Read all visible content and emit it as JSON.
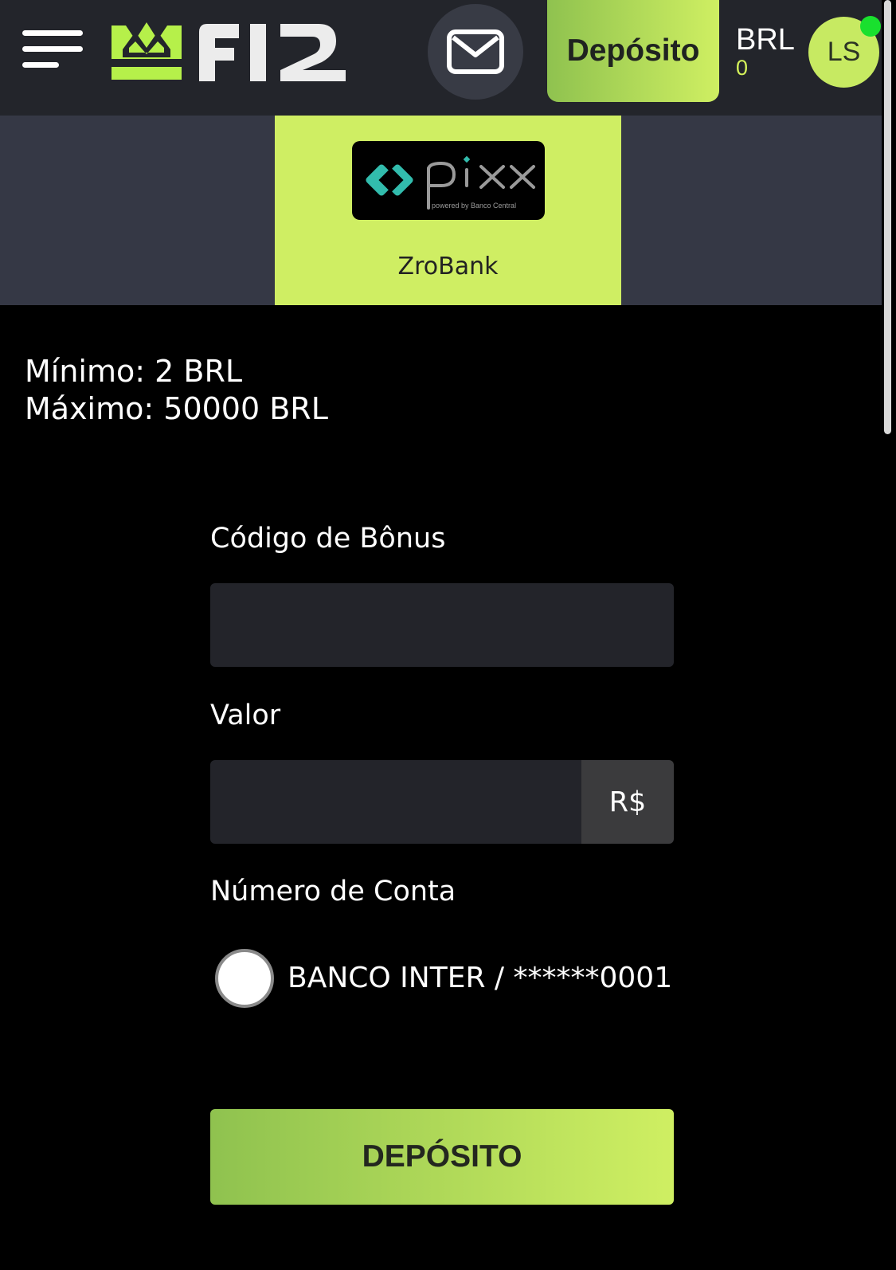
{
  "header": {
    "brand": "F12",
    "deposit_label": "Depósito",
    "currency": "BRL",
    "balance": "0",
    "avatar_initials": "LS"
  },
  "payment_methods": [
    {
      "logo_text": "pix",
      "logo_caption": "powered by Banco Central",
      "name": "ZroBank",
      "selected": true
    }
  ],
  "limits": {
    "minimum": "Mínimo: 2 BRL",
    "maximum": "Máximo: 50000 BRL"
  },
  "form": {
    "bonus_code": {
      "label": "Código de Bônus",
      "value": ""
    },
    "amount": {
      "label": "Valor",
      "value": "",
      "suffix": "R$"
    },
    "account": {
      "label": "Número de Conta",
      "options": [
        {
          "label": "BANCO INTER / ******0001",
          "selected": false
        }
      ]
    },
    "submit_label": "DEPÓSITO"
  },
  "colors": {
    "accent_start": "#8fc24f",
    "accent_end": "#cfef62",
    "header_bg": "#23252b",
    "methods_bg": "#353845",
    "online": "#19e02e"
  }
}
